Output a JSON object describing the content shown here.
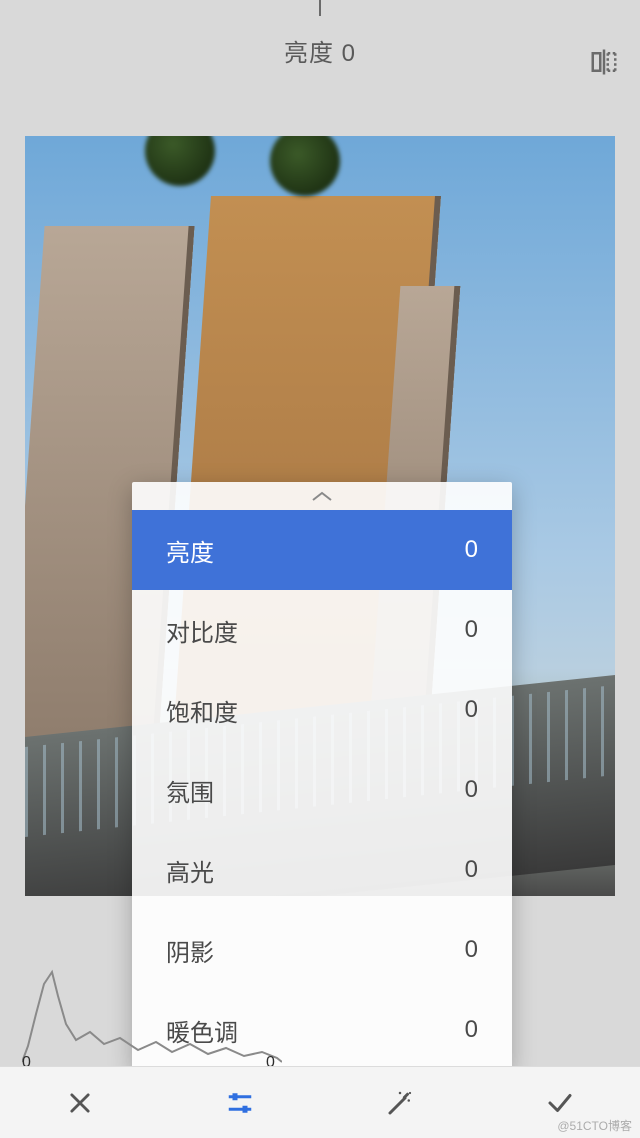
{
  "topbar": {
    "current_param": "亮度",
    "current_value": "0"
  },
  "adjustments": [
    {
      "label": "亮度",
      "value": "0",
      "selected": true
    },
    {
      "label": "对比度",
      "value": "0",
      "selected": false
    },
    {
      "label": "饱和度",
      "value": "0",
      "selected": false
    },
    {
      "label": "氛围",
      "value": "0",
      "selected": false
    },
    {
      "label": "高光",
      "value": "0",
      "selected": false
    },
    {
      "label": "阴影",
      "value": "0",
      "selected": false
    },
    {
      "label": "暖色调",
      "value": "0",
      "selected": false
    }
  ],
  "histogram": {
    "min_label": "0",
    "max_label": "0"
  },
  "watermark": "@51CTO博客"
}
